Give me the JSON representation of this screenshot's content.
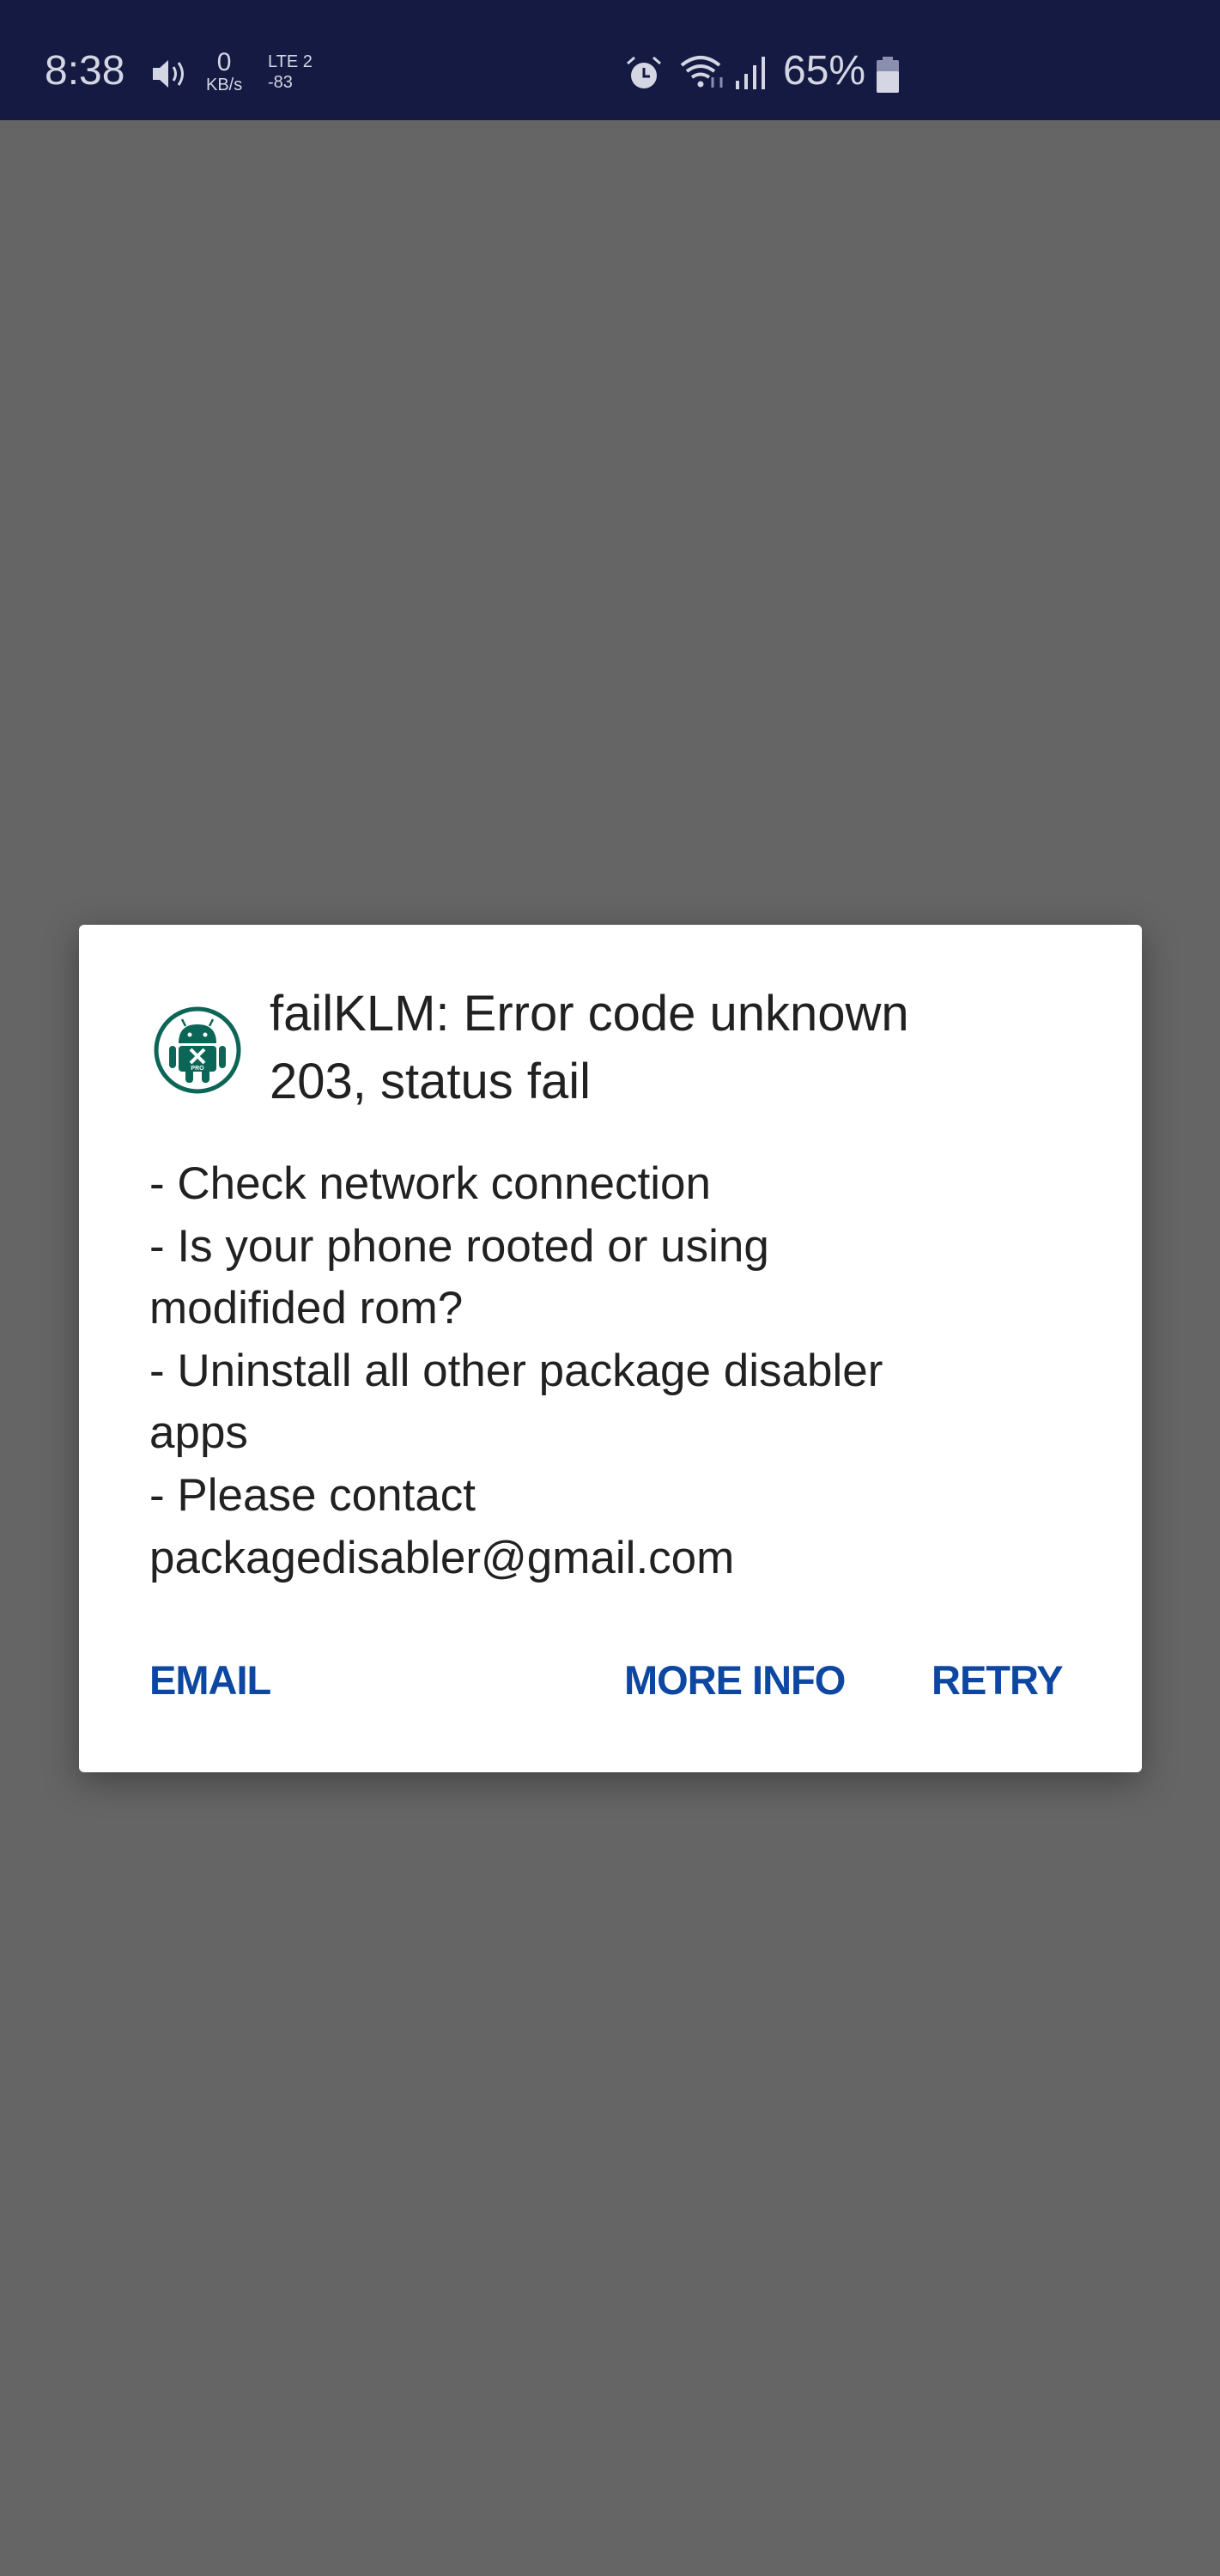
{
  "status_bar": {
    "time": "8:38",
    "net_speed_value": "0",
    "net_speed_unit": "KB/s",
    "network_type": "LTE 2",
    "signal_dbm": "-83",
    "battery_percent": "65%",
    "icons": [
      "volume-icon",
      "alarm-icon",
      "wifi-icon",
      "signal-icon",
      "battery-icon"
    ],
    "background": "#141a42"
  },
  "dialog": {
    "app_icon": "android-disabler-pro-icon",
    "app_icon_text": "PRO",
    "title_lines": [
      "failKLM: Error code unknown",
      "203, status fail"
    ],
    "message_lines": [
      "- Check network connection",
      "- Is your phone rooted or using",
      "modifided rom?",
      "- Uninstall all other package disabler",
      "apps",
      "- Please contact",
      "packagedisabler@gmail.com"
    ],
    "buttons": {
      "email": "EMAIL",
      "more_info": "MORE INFO",
      "retry": "RETRY"
    },
    "accent": "#0d47a1",
    "icon_color": "#0b6657"
  }
}
